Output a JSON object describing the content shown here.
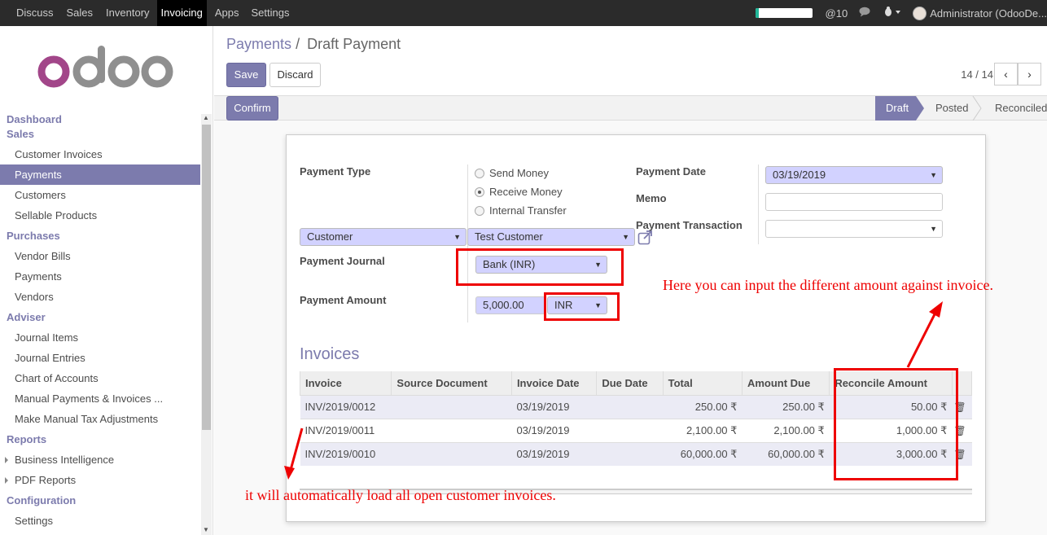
{
  "topbar": {
    "menu": [
      "Discuss",
      "Sales",
      "Inventory",
      "Invoicing",
      "Apps",
      "Settings"
    ],
    "active": "Invoicing",
    "progress": 0.07,
    "messages": "@10",
    "user": "Administrator (OdooDe..."
  },
  "logo": "odoo",
  "sidebar": {
    "sections": [
      {
        "title": "Dashboard",
        "items": []
      },
      {
        "title": "Sales",
        "items": [
          "Customer Invoices",
          "Payments",
          "Customers",
          "Sellable Products"
        ]
      },
      {
        "title": "Purchases",
        "items": [
          "Vendor Bills",
          "Payments",
          "Vendors"
        ]
      },
      {
        "title": "Adviser",
        "items": [
          "Journal Items",
          "Journal Entries",
          "Chart of Accounts",
          "Manual Payments & Invoices ...",
          "Make Manual Tax Adjustments"
        ]
      },
      {
        "title": "Reports",
        "items": [
          "Business Intelligence",
          "PDF Reports"
        ]
      },
      {
        "title": "Configuration",
        "items": [
          "Settings"
        ]
      }
    ],
    "active": "Payments"
  },
  "breadcrumb": {
    "parent": "Payments",
    "sep": "/",
    "current": "Draft Payment"
  },
  "buttons": {
    "save": "Save",
    "discard": "Discard",
    "confirm": "Confirm"
  },
  "pager": {
    "text": "14 / 14"
  },
  "stages": [
    "Draft",
    "Posted",
    "Reconciled"
  ],
  "current_stage": "Draft",
  "form": {
    "payment_type_label": "Payment Type",
    "radios": [
      {
        "label": "Send Money",
        "checked": false
      },
      {
        "label": "Receive Money",
        "checked": true
      },
      {
        "label": "Internal Transfer",
        "checked": false
      }
    ],
    "partner_type": "Customer",
    "partner": "Test Customer",
    "journal_label": "Payment Journal",
    "journal": "Bank (INR)",
    "amount_label": "Payment Amount",
    "amount": "5,000.00",
    "currency": "INR",
    "date_label": "Payment Date",
    "date": "03/19/2019",
    "memo_label": "Memo",
    "memo": "",
    "transaction_label": "Payment Transaction",
    "transaction": ""
  },
  "invoices": {
    "title": "Invoices",
    "columns": [
      "Invoice",
      "Source Document",
      "Invoice Date",
      "Due Date",
      "Total",
      "Amount Due",
      "Reconcile Amount"
    ],
    "rows": [
      {
        "invoice": "INV/2019/0012",
        "source": "",
        "date": "03/19/2019",
        "due": "",
        "total": "250.00 ₹",
        "amount_due": "250.00 ₹",
        "reconcile": "50.00 ₹"
      },
      {
        "invoice": "INV/2019/0011",
        "source": "",
        "date": "03/19/2019",
        "due": "",
        "total": "2,100.00 ₹",
        "amount_due": "2,100.00 ₹",
        "reconcile": "1,000.00 ₹"
      },
      {
        "invoice": "INV/2019/0010",
        "source": "",
        "date": "03/19/2019",
        "due": "",
        "total": "60,000.00 ₹",
        "amount_due": "60,000.00 ₹",
        "reconcile": "3,000.00 ₹"
      }
    ]
  },
  "annotations": {
    "top": "Here you can input the different amount against invoice.",
    "bottom": "it will automatically load all open customer invoices."
  },
  "colors": {
    "accent": "#7c7bad",
    "annotation": "#e00000",
    "progress": "#21b799"
  }
}
